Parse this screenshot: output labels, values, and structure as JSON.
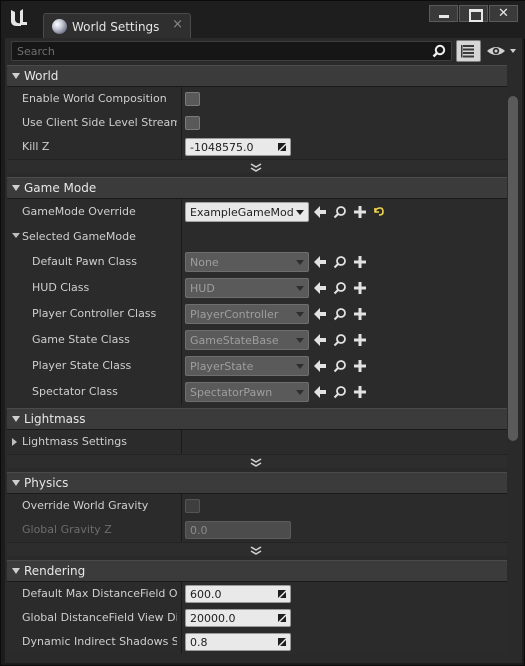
{
  "tab": {
    "title": "World Settings",
    "close": "×"
  },
  "window_buttons": {
    "close": "✕"
  },
  "search": {
    "placeholder": "Search",
    "value": ""
  },
  "categories": {
    "world": "World",
    "game_mode": "Game Mode",
    "lightmass": "Lightmass",
    "physics": "Physics",
    "rendering": "Rendering"
  },
  "world": {
    "enable_world_composition": {
      "label": "Enable World Composition",
      "checked": false
    },
    "use_client_side_level_streaming": {
      "label": "Use Client Side Level Streaming",
      "checked": false
    },
    "kill_z": {
      "label": "Kill Z",
      "value": "-1048575.0"
    }
  },
  "game_mode": {
    "override": {
      "label": "GameMode Override",
      "value": "ExampleGameModeBP"
    },
    "selected_gamemode": "Selected GameMode",
    "classes": [
      {
        "label": "Default Pawn Class",
        "value": "None"
      },
      {
        "label": "HUD Class",
        "value": "HUD"
      },
      {
        "label": "Player Controller Class",
        "value": "PlayerController"
      },
      {
        "label": "Game State Class",
        "value": "GameStateBase"
      },
      {
        "label": "Player State Class",
        "value": "PlayerState"
      },
      {
        "label": "Spectator Class",
        "value": "SpectatorPawn"
      }
    ]
  },
  "lightmass": {
    "settings": "Lightmass Settings"
  },
  "physics": {
    "override_world_gravity": {
      "label": "Override World Gravity",
      "checked": false
    },
    "global_gravity_z": {
      "label": "Global Gravity Z",
      "value": "0.0"
    }
  },
  "rendering": {
    "default_max_distancefield": {
      "label": "Default Max DistanceField Occlusion Distance",
      "value": "600.0"
    },
    "global_distancefield_view": {
      "label": "Global DistanceField View Distance",
      "value": "20000.0"
    },
    "dynamic_indirect_shadows": {
      "label": "Dynamic Indirect Shadows Self Shadowing Intensity",
      "value": "0.8"
    }
  },
  "colors": {
    "accent_reset": "#f2d44a",
    "panel": "#2a2a2a",
    "category_header": "#3b3b3b"
  },
  "icons": {
    "logo": "unreal-logo-icon",
    "tab": "globe-icon",
    "search": "search-icon",
    "view_options": "eye-icon",
    "property_matrix": "property-matrix-icon",
    "use_selected": "arrow-left-icon",
    "browse": "magnifier-icon",
    "add": "plus-icon",
    "reset": "reset-to-default-icon"
  }
}
